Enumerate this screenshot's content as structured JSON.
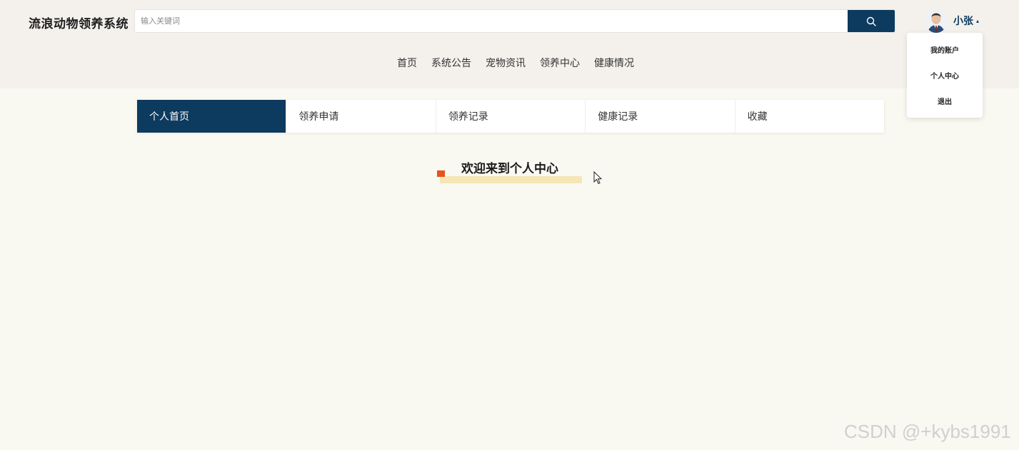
{
  "header": {
    "logo": "流浪动物领养系统",
    "search": {
      "placeholder": "输入关键词",
      "value": "",
      "button_icon": "search-icon"
    },
    "user": {
      "name": "小张",
      "caret": "▴",
      "avatar_icon": "user-avatar"
    },
    "nav": [
      "首页",
      "系统公告",
      "宠物资讯",
      "领养中心",
      "健康情况"
    ]
  },
  "dropdown": [
    "我的账户",
    "个人中心",
    "退出"
  ],
  "tabs": [
    "个人首页",
    "领养申请",
    "领养记录",
    "健康记录",
    "收藏"
  ],
  "active_tab": "个人首页",
  "welcome": "欢迎来到个人中心",
  "watermark": "CSDN @+kybs1991",
  "colors": {
    "primary": "#0d3a5f",
    "header_bg": "#f4f1ec",
    "page_bg": "#f9f8f1",
    "highlight": "#f6e6b6",
    "flag": "#e4541d"
  }
}
